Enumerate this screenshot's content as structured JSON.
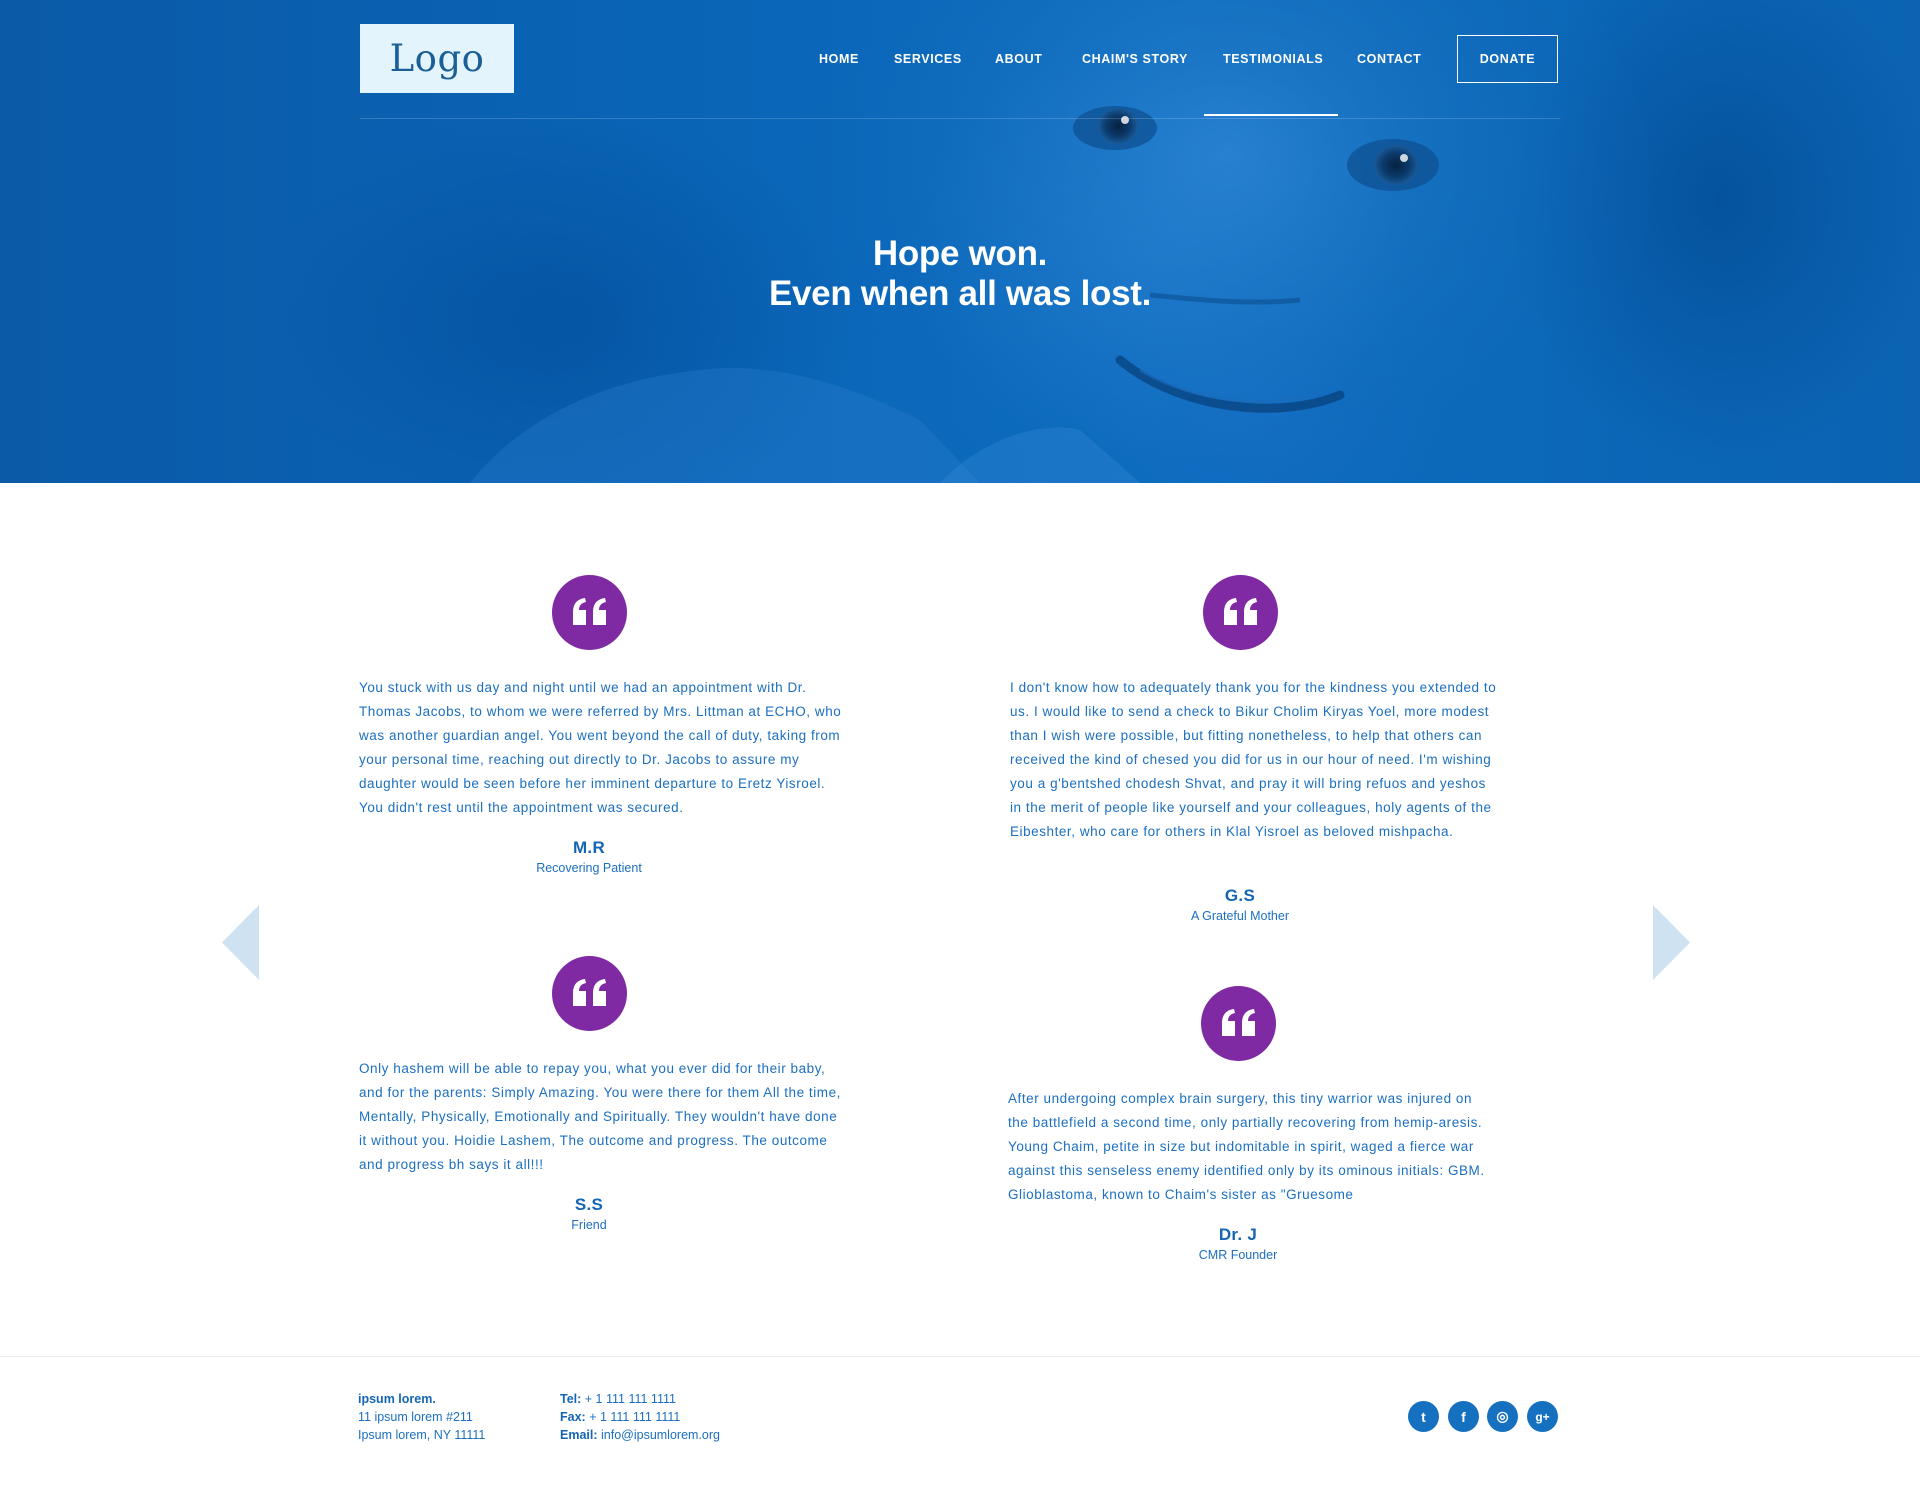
{
  "header": {
    "logo": "Logo",
    "nav": [
      {
        "label": "HOME"
      },
      {
        "label": "SERVICES"
      },
      {
        "label": "ABOUT"
      },
      {
        "label": "CHAIM'S STORY"
      },
      {
        "label": "TESTIMONIALS"
      },
      {
        "label": "CONTACT"
      }
    ],
    "active_item": "TESTIMONIALS",
    "donate": "DONATE"
  },
  "hero": {
    "line1": "Hope won.",
    "line2": "Even when all was lost."
  },
  "testimonials": [
    {
      "text": "You stuck with us day and night until we had an appointment with Dr. Thomas Jacobs, to whom we were referred by Mrs. Littman at ECHO, who was another guardian angel. You went beyond the call of duty, taking from your personal time, reaching out directly to Dr. Jacobs to assure my daughter would be seen before her imminent departure to Eretz Yisroel. You didn't rest until the appointment was secured.",
      "name": "M.R",
      "role": "Recovering Patient"
    },
    {
      "text": "I don't know how to adequately thank you for the kindness you extended to us. I would like to send a check to Bikur Cholim Kiryas Yoel, more modest than I wish were possible, but fitting nonetheless, to help that others can received the kind of chesed you did for us in our hour of need. I'm wishing you a g'bentshed chodesh Shvat, and pray it will bring refuos and yeshos in the merit of people like yourself and your colleagues, holy agents of the Eibeshter, who care for others in Klal Yisroel as beloved mishpacha.",
      "name": "G.S",
      "role": "A Grateful Mother"
    },
    {
      "text": "Only hashem will be able to repay you, what you ever did for their baby, and for the parents: Simply Amazing. You were there for them All the time, Mentally, Physically, Emotionally and Spiritually. They wouldn't have done it without you. Hoidie Lashem, The outcome and progress. The outcome and progress bh says it all!!!",
      "name": "S.S",
      "role": "Friend"
    },
    {
      "text": "After undergoing complex brain surgery, this tiny warrior was injured on the battlefield a second time, only partially recovering from hemip-aresis. Young Chaim, petite in size but indomitable in spirit, waged a fierce war against this senseless enemy identified only by its ominous initials: GBM. Glioblastoma, known to Chaim's sister as \"Gruesome",
      "name": "Dr. J",
      "role": "CMR Founder"
    }
  ],
  "footer": {
    "org_name": "ipsum lorem.",
    "address1": "11 ipsum lorem #211",
    "address2": "Ipsum lorem, NY 11111",
    "tel_label": "Tel:",
    "tel": "+ 1 111 111 1111",
    "fax_label": "Fax:",
    "fax": "+ 1 111 111 1111",
    "email_label": "Email:",
    "email": "info@ipsumlorem.org",
    "social": [
      {
        "icon": "twitter-icon",
        "glyph": "t"
      },
      {
        "icon": "facebook-icon",
        "glyph": "f"
      },
      {
        "icon": "instagram-icon",
        "glyph": "◎"
      },
      {
        "icon": "google-plus-icon",
        "glyph": "g+"
      }
    ]
  },
  "colors": {
    "hero_blue": "#0b63b2",
    "quote_purple": "#7f2aa3",
    "text_blue": "#1c6fc0",
    "arrow_blue": "#cfe2f1"
  }
}
